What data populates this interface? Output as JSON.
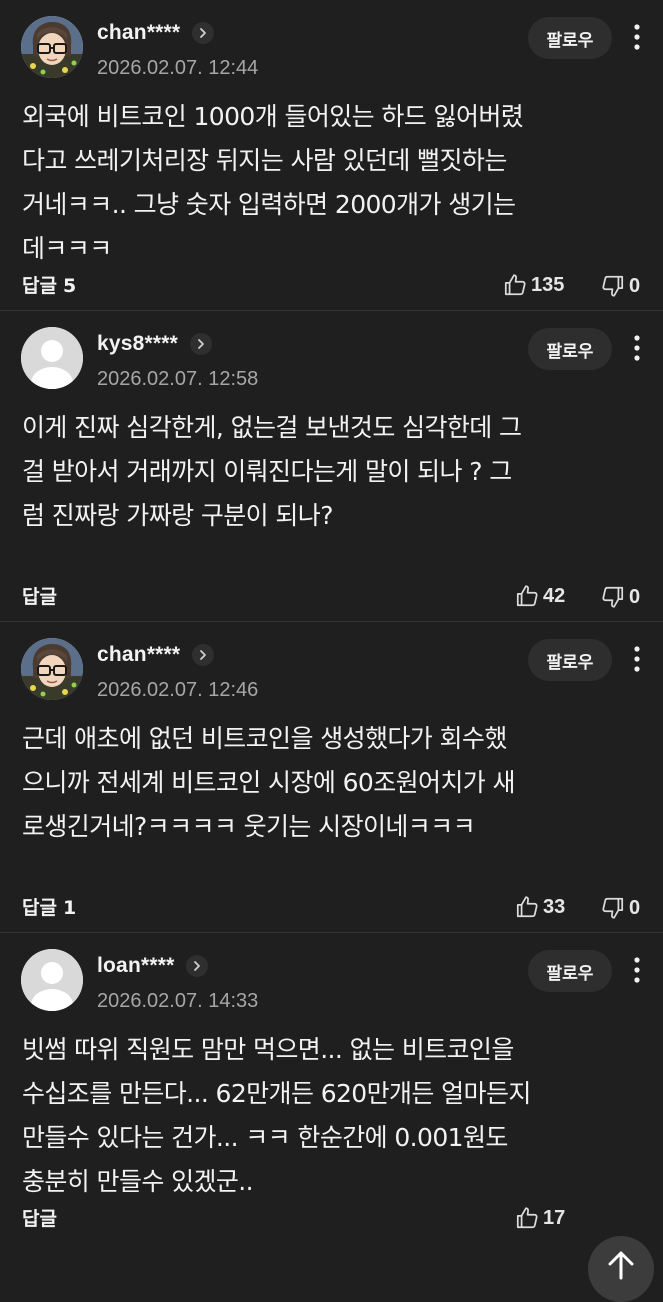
{
  "comments": [
    {
      "username": "chan****",
      "avatar": "cartoon-glasses",
      "timestamp": "2026.02.07. 12:44",
      "follow_label": "팔로우",
      "body": "외국에 비트코인 1000개 들어있는 하드 잃어버렸\n다고 쓰레기처리장 뒤지는 사람 있던데 뻘짓하는\n거네ㅋㅋ.. 그냥 숫자 입력하면 2000개가 생기는\n데ㅋㅋㅋ",
      "reply_label": "답글",
      "reply_count": "5",
      "likes": "135",
      "dislikes": "0"
    },
    {
      "username": "kys8****",
      "avatar": "default",
      "timestamp": "2026.02.07. 12:58",
      "follow_label": "팔로우",
      "body": "이게 진짜 심각한게, 없는걸 보낸것도 심각한데 그\n걸 받아서 거래까지 이뤄진다는게 말이 되나 ? 그\n럼 진짜랑 가짜랑 구분이 되나?",
      "reply_label": "답글",
      "reply_count": "",
      "likes": "42",
      "dislikes": "0"
    },
    {
      "username": "chan****",
      "avatar": "cartoon-glasses",
      "timestamp": "2026.02.07. 12:46",
      "follow_label": "팔로우",
      "body": "근데 애초에 없던 비트코인을 생성했다가 회수했\n으니까 전세계 비트코인 시장에 60조원어치가 새\n로생긴거네?ㅋㅋㅋㅋ 웃기는 시장이네ㅋㅋㅋ",
      "reply_label": "답글",
      "reply_count": "1",
      "likes": "33",
      "dislikes": "0"
    },
    {
      "username": "loan****",
      "avatar": "default",
      "timestamp": "2026.02.07. 14:33",
      "follow_label": "팔로우",
      "body": "빗썸 따위 직원도 맘만 먹으면... 없는 비트코인을\n수십조를 만든다... 62만개든 620만개든 얼마든지\n만들수 있다는 건가... ㅋㅋ 한순간에 0.001원도\n충분히 만들수 있겠군..",
      "reply_label": "답글",
      "reply_count": "",
      "likes": "17",
      "dislikes": ""
    }
  ],
  "icons": {
    "like": "thumbs-up-icon",
    "dislike": "thumbs-down-icon",
    "more": "more-vertical-icon",
    "chevron": "chevron-right-icon",
    "scroll_top": "arrow-up-icon"
  },
  "colors": {
    "background": "#1f1f1f",
    "text": "#f2f2f2",
    "secondary_text": "#a6a6a6",
    "button_bg": "#2e2e2e"
  }
}
